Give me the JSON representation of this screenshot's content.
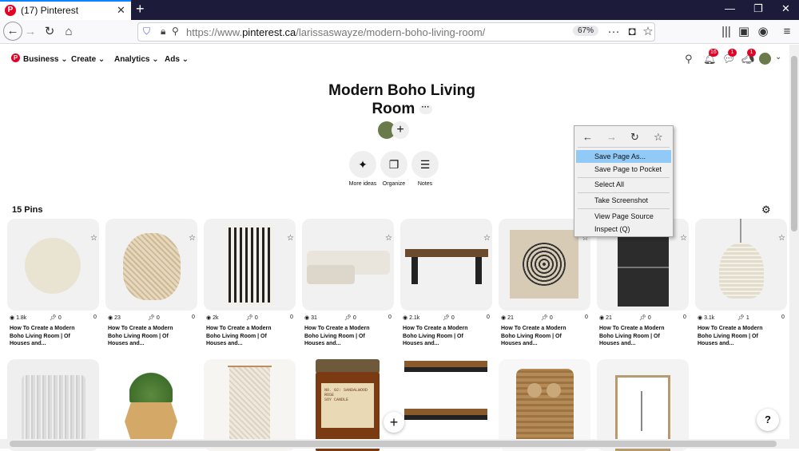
{
  "browser": {
    "tab_title": "(17) Pinterest",
    "tab_close": "✕",
    "new_tab": "+",
    "url_prefix": "https://www.",
    "url_domain": "pinterest.ca",
    "url_path": "/larissaswayze/modern-boho-living-room/",
    "zoom": "67%"
  },
  "header": {
    "menus": [
      {
        "label": "Business"
      },
      {
        "label": "Create"
      },
      {
        "label": "Analytics"
      },
      {
        "label": "Ads"
      }
    ],
    "badges": {
      "notifications": "16",
      "messages": "1",
      "updates": "1"
    }
  },
  "board": {
    "title": "Modern Boho Living Room",
    "actions": [
      {
        "label": "More ideas",
        "icon": "sparkle-icon"
      },
      {
        "label": "Organize",
        "icon": "organize-icon"
      },
      {
        "label": "Notes",
        "icon": "notes-icon"
      }
    ],
    "pins_count": "15 Pins"
  },
  "pins": [
    {
      "views": "1.8k",
      "saves": "0",
      "comments": "0",
      "desc": "How To Create a Modern Boho Living Room | Of Houses and..."
    },
    {
      "views": "23",
      "saves": "0",
      "comments": "0",
      "desc": "How To Create a Modern Boho Living Room | Of Houses and..."
    },
    {
      "views": "2k",
      "saves": "0",
      "comments": "0",
      "desc": "How To Create a Modern Boho Living Room | Of Houses and..."
    },
    {
      "views": "31",
      "saves": "0",
      "comments": "0",
      "desc": "How To Create a Modern Boho Living Room | Of Houses and..."
    },
    {
      "views": "2.1k",
      "saves": "0",
      "comments": "0",
      "desc": "How To Create a Modern Boho Living Room | Of Houses and..."
    },
    {
      "views": "21",
      "saves": "0",
      "comments": "0",
      "desc": "How To Create a Modern Boho Living Room | Of Houses and..."
    },
    {
      "views": "21",
      "saves": "0",
      "comments": "0",
      "desc": "How To Create a Modern Boho Living Room | Of Houses and..."
    },
    {
      "views": "3.1k",
      "saves": "1",
      "comments": "0",
      "desc": "How To Create a Modern Boho Living Room | Of Houses and..."
    }
  ],
  "candle_label": "NO. 02: SANDALWOOD ROSE\nSOY CANDLE",
  "context_menu": {
    "items": [
      {
        "label": "Save Page As..."
      },
      {
        "label": "Save Page to Pocket"
      },
      {
        "label": "Select All"
      },
      {
        "label": "Take Screenshot"
      },
      {
        "label": "View Page Source"
      },
      {
        "label": "Inspect (Q)"
      }
    ]
  },
  "help_label": "?",
  "colors": {
    "brand": "#e60023",
    "highlight": "#91c9f7",
    "chrome": "#1c1b3a"
  }
}
